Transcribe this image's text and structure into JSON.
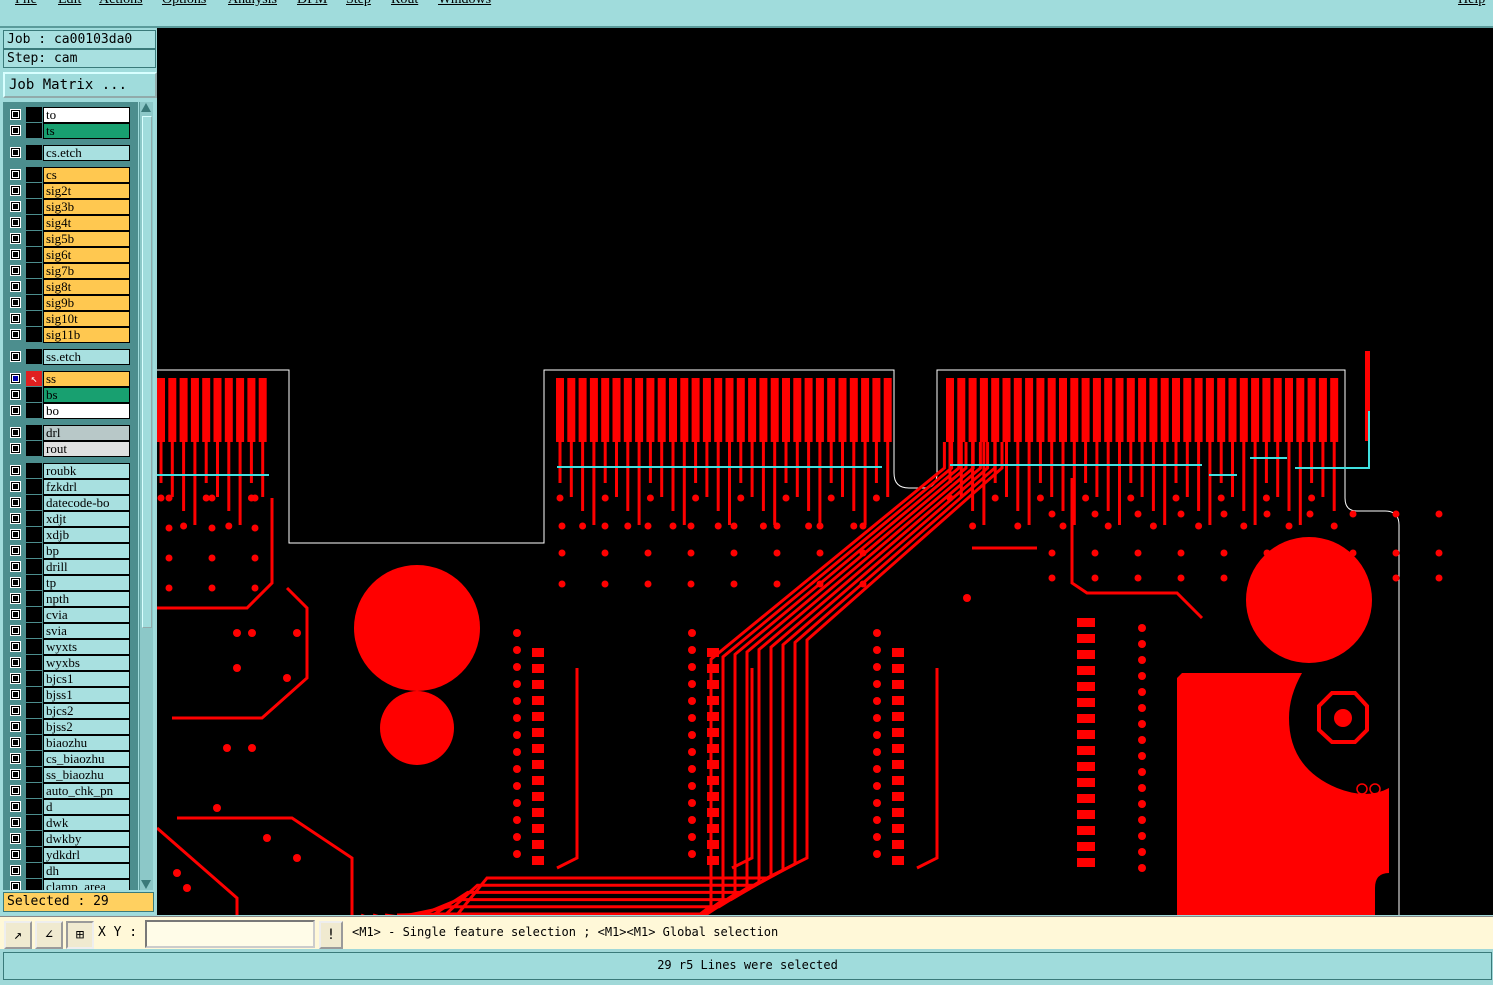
{
  "menu": [
    "File",
    "Edit",
    "Actions",
    "Options",
    "Analysis",
    "DFM",
    "Step",
    "Rout",
    "Windows"
  ],
  "help": "Help",
  "job_label": "Job : ca00103da0",
  "step_label": "Step: cam",
  "job_matrix_button": "Job Matrix ...",
  "layers": [
    {
      "name": "to",
      "color": "#ffffff"
    },
    {
      "name": "ts",
      "color": "#18a070"
    },
    {
      "name": "cs.etch",
      "color": "#a8e0e0"
    },
    {
      "name": "cs",
      "color": "#ffc850"
    },
    {
      "name": "sig2t",
      "color": "#ffc850"
    },
    {
      "name": "sig3b",
      "color": "#ffc850"
    },
    {
      "name": "sig4t",
      "color": "#ffc850"
    },
    {
      "name": "sig5b",
      "color": "#ffc850"
    },
    {
      "name": "sig6t",
      "color": "#ffc850"
    },
    {
      "name": "sig7b",
      "color": "#ffc850"
    },
    {
      "name": "sig8t",
      "color": "#ffc850"
    },
    {
      "name": "sig9b",
      "color": "#ffc850"
    },
    {
      "name": "sig10t",
      "color": "#ffc850"
    },
    {
      "name": "sig11b",
      "color": "#ffc850"
    },
    {
      "name": "ss.etch",
      "color": "#a8e0e0"
    },
    {
      "name": "ss",
      "color": "#ffc850"
    },
    {
      "name": "bs",
      "color": "#18a070"
    },
    {
      "name": "bo",
      "color": "#ffffff"
    },
    {
      "name": "drl",
      "color": "#b8c8c8"
    },
    {
      "name": "rout",
      "color": "#e0e0e0"
    },
    {
      "name": "roubk",
      "color": "#a8e0e0"
    },
    {
      "name": "fzkdrl",
      "color": "#a8e0e0"
    },
    {
      "name": "datecode-bo",
      "color": "#a8e0e0"
    },
    {
      "name": "xdjt",
      "color": "#a8e0e0"
    },
    {
      "name": "xdjb",
      "color": "#a8e0e0"
    },
    {
      "name": "bp",
      "color": "#a8e0e0"
    },
    {
      "name": "drill",
      "color": "#a8e0e0"
    },
    {
      "name": "tp",
      "color": "#a8e0e0"
    },
    {
      "name": "npth",
      "color": "#a8e0e0"
    },
    {
      "name": "cvia",
      "color": "#a8e0e0"
    },
    {
      "name": "svia",
      "color": "#a8e0e0"
    },
    {
      "name": "wyxts",
      "color": "#a8e0e0"
    },
    {
      "name": "wyxbs",
      "color": "#a8e0e0"
    },
    {
      "name": "bjcs1",
      "color": "#a8e0e0"
    },
    {
      "name": "bjss1",
      "color": "#a8e0e0"
    },
    {
      "name": "bjcs2",
      "color": "#a8e0e0"
    },
    {
      "name": "bjss2",
      "color": "#a8e0e0"
    },
    {
      "name": "biaozhu",
      "color": "#a8e0e0"
    },
    {
      "name": "cs_biaozhu",
      "color": "#a8e0e0"
    },
    {
      "name": "ss_biaozhu",
      "color": "#a8e0e0"
    },
    {
      "name": "auto_chk_pn",
      "color": "#a8e0e0"
    },
    {
      "name": "d",
      "color": "#a8e0e0"
    },
    {
      "name": "dwk",
      "color": "#a8e0e0"
    },
    {
      "name": "dwkby",
      "color": "#a8e0e0"
    },
    {
      "name": "ydkdrl",
      "color": "#a8e0e0"
    },
    {
      "name": "dh",
      "color": "#a8e0e0"
    },
    {
      "name": "clamp_area",
      "color": "#a8e0e0"
    }
  ],
  "active_layer": "ss",
  "selected_count": "Selected : 29",
  "xy_label": "X Y :",
  "xy_value": "",
  "hint": "<M1> - Single feature selection ; <M1><M1> Global selection",
  "status": "29 r5 Lines were selected",
  "colors": {
    "copper": "#ff0000",
    "selection": "#40e0e0",
    "panel": "#a0dcdc"
  }
}
